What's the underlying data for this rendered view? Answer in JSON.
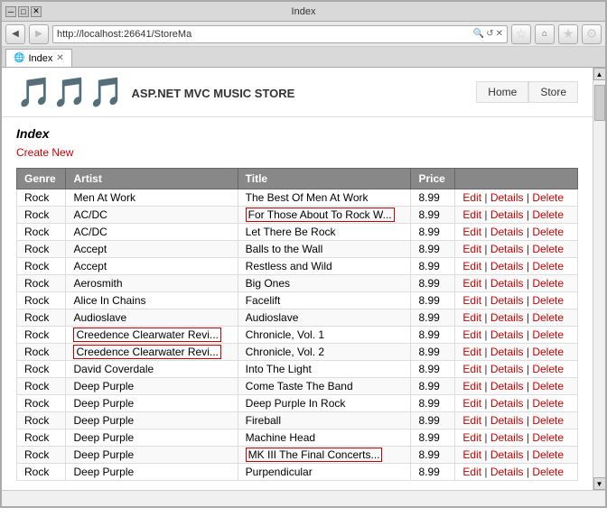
{
  "browser": {
    "title_bar": {
      "title": "Index",
      "minimize": "─",
      "maximize": "□",
      "close": "✕"
    },
    "address": "http://localhost:26641/StoreMa",
    "tab_label": "Index",
    "nav": {
      "back": "◀",
      "forward": "▶",
      "search_placeholder": "🔍"
    },
    "header_nav": {
      "home": "Home",
      "store": "Store"
    }
  },
  "page": {
    "logo_text": "🎵",
    "site_title": "ASP.NET MVC MUSIC STORE",
    "heading": "Index",
    "create_link": "Create New",
    "table": {
      "headers": [
        "Genre",
        "Artist",
        "Title",
        "Price"
      ],
      "rows": [
        {
          "genre": "Rock",
          "artist": "Men At Work",
          "title": "The Best Of Men At Work",
          "price": "8.99",
          "title_truncated": false,
          "artist_truncated": false
        },
        {
          "genre": "Rock",
          "artist": "AC/DC",
          "title": "For Those About To Rock W...",
          "price": "8.99",
          "title_truncated": true,
          "artist_truncated": false
        },
        {
          "genre": "Rock",
          "artist": "AC/DC",
          "title": "Let There Be Rock",
          "price": "8.99",
          "title_truncated": false,
          "artist_truncated": false
        },
        {
          "genre": "Rock",
          "artist": "Accept",
          "title": "Balls to the Wall",
          "price": "8.99",
          "title_truncated": false,
          "artist_truncated": false
        },
        {
          "genre": "Rock",
          "artist": "Accept",
          "title": "Restless and Wild",
          "price": "8.99",
          "title_truncated": false,
          "artist_truncated": false
        },
        {
          "genre": "Rock",
          "artist": "Aerosmith",
          "title": "Big Ones",
          "price": "8.99",
          "title_truncated": false,
          "artist_truncated": false
        },
        {
          "genre": "Rock",
          "artist": "Alice In Chains",
          "title": "Facelift",
          "price": "8.99",
          "title_truncated": false,
          "artist_truncated": false
        },
        {
          "genre": "Rock",
          "artist": "Audioslave",
          "title": "Audioslave",
          "price": "8.99",
          "title_truncated": false,
          "artist_truncated": false
        },
        {
          "genre": "Rock",
          "artist": "Creedence Clearwater Revi...",
          "title": "Chronicle, Vol. 1",
          "price": "8.99",
          "title_truncated": false,
          "artist_truncated": true
        },
        {
          "genre": "Rock",
          "artist": "Creedence Clearwater Revi...",
          "title": "Chronicle, Vol. 2",
          "price": "8.99",
          "title_truncated": false,
          "artist_truncated": true
        },
        {
          "genre": "Rock",
          "artist": "David Coverdale",
          "title": "Into The Light",
          "price": "8.99",
          "title_truncated": false,
          "artist_truncated": false
        },
        {
          "genre": "Rock",
          "artist": "Deep Purple",
          "title": "Come Taste The Band",
          "price": "8.99",
          "title_truncated": false,
          "artist_truncated": false
        },
        {
          "genre": "Rock",
          "artist": "Deep Purple",
          "title": "Deep Purple In Rock",
          "price": "8.99",
          "title_truncated": false,
          "artist_truncated": false
        },
        {
          "genre": "Rock",
          "artist": "Deep Purple",
          "title": "Fireball",
          "price": "8.99",
          "title_truncated": false,
          "artist_truncated": false
        },
        {
          "genre": "Rock",
          "artist": "Deep Purple",
          "title": "Machine Head",
          "price": "8.99",
          "title_truncated": false,
          "artist_truncated": false
        },
        {
          "genre": "Rock",
          "artist": "Deep Purple",
          "title": "MK III The Final Concerts...",
          "price": "8.99",
          "title_truncated": true,
          "artist_truncated": false
        },
        {
          "genre": "Rock",
          "artist": "Deep Purple",
          "title": "Purpendicular",
          "price": "8.99",
          "title_truncated": false,
          "artist_truncated": false
        }
      ],
      "actions": [
        "Edit",
        "Details",
        "Delete"
      ]
    }
  }
}
